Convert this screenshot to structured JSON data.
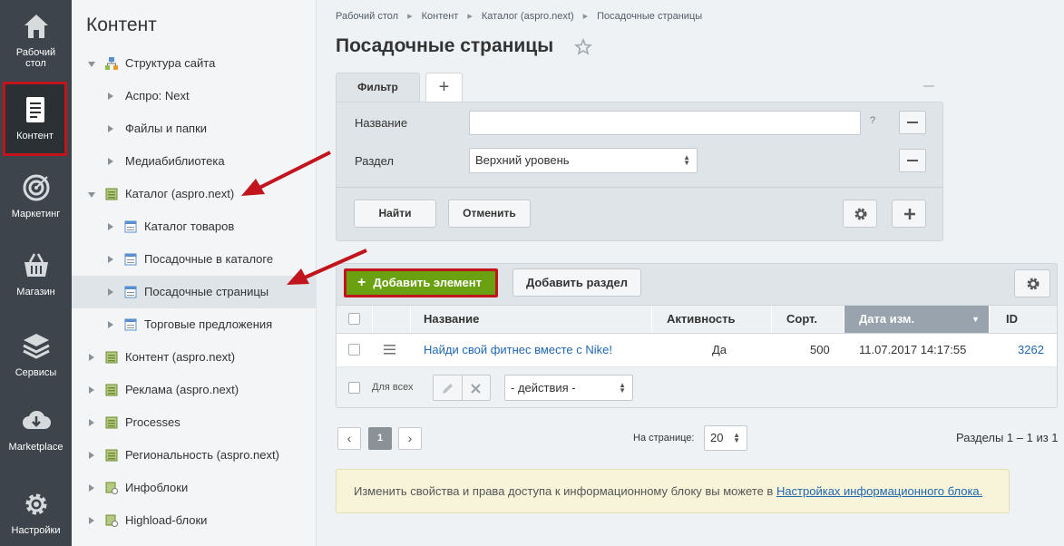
{
  "leftnav": {
    "items": [
      {
        "label_lines": [
          "Рабочий",
          "стол"
        ],
        "icon": "house-icon"
      },
      {
        "label_lines": [
          "Контент"
        ],
        "icon": "document-icon"
      },
      {
        "label_lines": [
          "Маркетинг"
        ],
        "icon": "target-icon"
      },
      {
        "label_lines": [
          "Магазин"
        ],
        "icon": "basket-icon"
      },
      {
        "label_lines": [
          "Сервисы"
        ],
        "icon": "layers-icon"
      },
      {
        "label_lines": [
          "Marketplace"
        ],
        "icon": "cloud-download-icon"
      },
      {
        "label_lines": [
          "Настройки"
        ],
        "icon": "gear-icon"
      }
    ]
  },
  "tree": {
    "title": "Контент",
    "items": [
      {
        "label": "Структура сайта",
        "icon": "site-structure-icon",
        "expanded": true
      },
      {
        "label": "Аспро: Next",
        "icon": "",
        "expanded": false
      },
      {
        "label": "Файлы и папки",
        "icon": "",
        "expanded": false
      },
      {
        "label": "Медиабиблиотека",
        "icon": "",
        "expanded": false
      },
      {
        "label": "Каталог (aspro.next)",
        "icon": "iblock-type-icon",
        "expanded": true
      },
      {
        "label": "Каталог товаров",
        "icon": "iblock-icon",
        "expanded": false
      },
      {
        "label": "Посадочные в каталоге",
        "icon": "iblock-icon",
        "expanded": false
      },
      {
        "label": "Посадочные страницы",
        "icon": "iblock-icon",
        "expanded": false,
        "selected": true
      },
      {
        "label": "Торговые предложения",
        "icon": "iblock-icon",
        "expanded": false
      },
      {
        "label": "Контент (aspro.next)",
        "icon": "iblock-type-icon",
        "expanded": false
      },
      {
        "label": "Реклама (aspro.next)",
        "icon": "iblock-type-icon",
        "expanded": false
      },
      {
        "label": "Processes",
        "icon": "iblock-type-icon",
        "expanded": false
      },
      {
        "label": "Региональность (aspro.next)",
        "icon": "iblock-type-icon",
        "expanded": false
      },
      {
        "label": "Инфоблоки",
        "icon": "iblock-settings-icon",
        "expanded": false
      },
      {
        "label": "Highload-блоки",
        "icon": "iblock-settings-icon",
        "expanded": false
      }
    ]
  },
  "breadcrumbs": [
    "Рабочий стол",
    "Контент",
    "Каталог (aspro.next)",
    "Посадочные страницы"
  ],
  "page_title": "Посадочные страницы",
  "filter": {
    "tab_label": "Фильтр",
    "add_tab_label": "+",
    "name_label": "Название",
    "name_value": "",
    "help_mark": "?",
    "section_label": "Раздел",
    "section_value": "Верхний уровень",
    "find_label": "Найти",
    "cancel_label": "Отменить"
  },
  "grid": {
    "add_element_label": "Добавить элемент",
    "add_section_label": "Добавить раздел",
    "columns": [
      "Название",
      "Активность",
      "Сорт.",
      "Дата изм.",
      "ID"
    ],
    "sorted_column": "Дата изм.",
    "rows": [
      {
        "name": "Найди свой фитнес вместе с Nike!",
        "active": "Да",
        "sort": "500",
        "date": "11.07.2017 14:17:55",
        "id": "3262"
      }
    ],
    "for_all_label": "Для всех",
    "actions_value": "- действия -"
  },
  "pager": {
    "prev": "‹",
    "current": "1",
    "next": "›",
    "per_page_label": "На странице:",
    "per_page_value": "20",
    "summary": "Разделы 1 – 1 из 1"
  },
  "notice": {
    "text": "Изменить свойства и права доступа к информационному блоку вы можете в ",
    "link": "Настройках информационного блока."
  },
  "colors": {
    "nav_bg": "#3d444c",
    "highlight_red": "#c2141c",
    "add_button_green": "#6aa111",
    "link_blue": "#2067b0",
    "notice_bg": "#f7f4d9"
  }
}
